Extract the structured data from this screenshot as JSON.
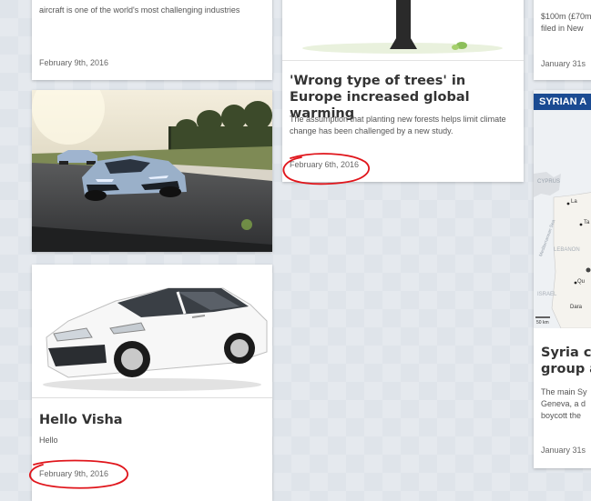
{
  "colors": {
    "background": "#dfe4ea",
    "card": "#ffffff",
    "title_text": "#333333",
    "annotation_red": "#e0151b",
    "syria_banner": "#1b4b92"
  },
  "cards": {
    "top_left": {
      "excerpt": "aircraft is one of the world's most challenging industries",
      "date": "February 9th, 2016"
    },
    "car_photo": {
      "image": "sports-car-on-track-photo"
    },
    "hello_visha": {
      "image": "white-sedan-photo",
      "title": "Hello Visha",
      "excerpt": "Hello",
      "date": "February 9th, 2016"
    },
    "trees": {
      "image": "tree-illustration",
      "title": "'Wrong type of trees' in Europe increased global warming",
      "excerpt": "The assumption that planting new forests helps limit climate change has been challenged by a new study.",
      "date": "February 6th, 2016"
    },
    "right_top": {
      "excerpt_line1": "$100m (£70m",
      "excerpt_line2": "filed in New",
      "date": "January 31s"
    },
    "syria": {
      "banner": "SYRIAN A",
      "map_labels": [
        "CYPRUS",
        "La",
        "Ta",
        "LEBANON",
        "Qu",
        "ISRAEL",
        "Dara",
        "50 km",
        "Mediterranean Sea"
      ],
      "title_line1": "Syria co",
      "title_line2": "group a",
      "excerpt_line1": "The main Sy",
      "excerpt_line2": "Geneva, a d",
      "excerpt_line3": "boycott the",
      "date": "January 31s"
    }
  }
}
